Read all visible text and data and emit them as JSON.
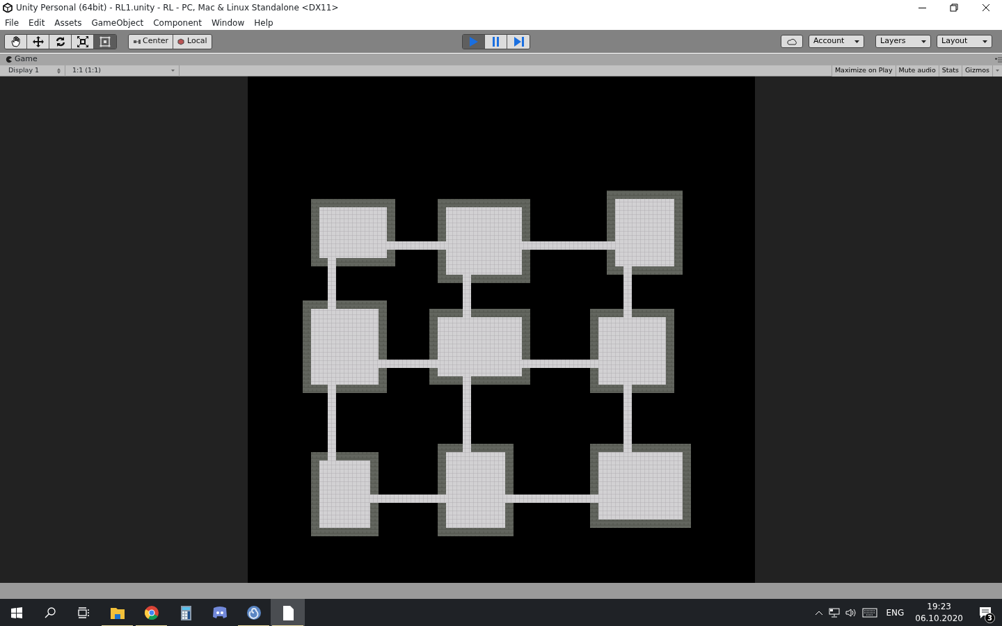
{
  "window": {
    "title": "Unity Personal (64bit) - RL1.unity - RL - PC, Mac & Linux Standalone <DX11>"
  },
  "menu": [
    "File",
    "Edit",
    "Assets",
    "GameObject",
    "Component",
    "Window",
    "Help"
  ],
  "tools": [
    {
      "kind": "hand",
      "selected": false
    },
    {
      "kind": "move",
      "selected": false
    },
    {
      "kind": "rotate",
      "selected": false
    },
    {
      "kind": "scale",
      "selected": false
    },
    {
      "kind": "rect",
      "selected": true
    }
  ],
  "pivot": [
    {
      "kind": "center",
      "label": "Center"
    },
    {
      "kind": "local",
      "label": "Local"
    }
  ],
  "playback": [
    {
      "kind": "play",
      "selected": true
    },
    {
      "kind": "pause",
      "selected": false
    },
    {
      "kind": "step",
      "selected": false
    }
  ],
  "dropdowns": [
    {
      "label": "Account"
    },
    {
      "label": "Layers"
    },
    {
      "label": "Layout"
    }
  ],
  "game_view": {
    "tab": "Game",
    "display": "Display 1",
    "scale": "1:1 (1:1)",
    "toggles": [
      {
        "label": "Maximize on Play",
        "selected": false
      },
      {
        "label": "Mute audio",
        "selected": false
      },
      {
        "label": "Stats",
        "selected": false
      },
      {
        "label": "Gizmos",
        "selected": false
      }
    ]
  },
  "taskbar": {
    "apps": [
      {
        "kind": "folder",
        "running": true,
        "active": false
      },
      {
        "kind": "browser",
        "running": true,
        "active": false
      },
      {
        "kind": "calculator",
        "running": false,
        "active": false
      },
      {
        "kind": "chat",
        "running": false,
        "active": false
      },
      {
        "kind": "swirl",
        "running": true,
        "active": false
      },
      {
        "kind": "document",
        "running": true,
        "active": true
      }
    ],
    "language": "ENG",
    "time": "19:23",
    "date": "06.10.2020",
    "notifications": "3"
  }
}
